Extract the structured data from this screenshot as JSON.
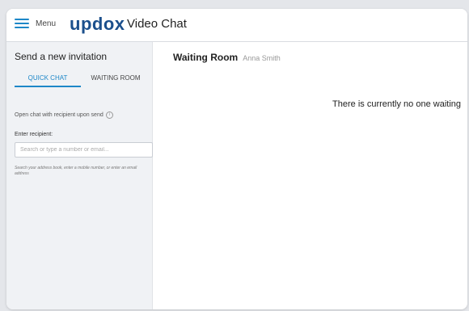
{
  "header": {
    "menu_label": "Menu",
    "logo_text": "updox",
    "app_title": "Video Chat"
  },
  "sidebar": {
    "title": "Send a new invitation",
    "tabs": [
      {
        "label": "QUICK CHAT",
        "active": true
      },
      {
        "label": "WAITING ROOM",
        "active": false
      }
    ],
    "open_chat_label": "Open chat with recipient upon send",
    "recipient_label": "Enter recipient:",
    "recipient_placeholder": "Search or type a number or email...",
    "recipient_value": "",
    "hint": "Search your address book, enter a mobile number, or enter an email address"
  },
  "main": {
    "waiting_room_title": "Waiting Room",
    "waiting_room_user": "Anna Smith",
    "empty_message": "There is currently no one waiting"
  },
  "colors": {
    "accent": "#1d87c8",
    "logo": "#1b4f8c",
    "sidebar_bg": "#f0f2f5"
  },
  "icons": {
    "menu": "hamburger-icon",
    "info": "info-icon"
  }
}
